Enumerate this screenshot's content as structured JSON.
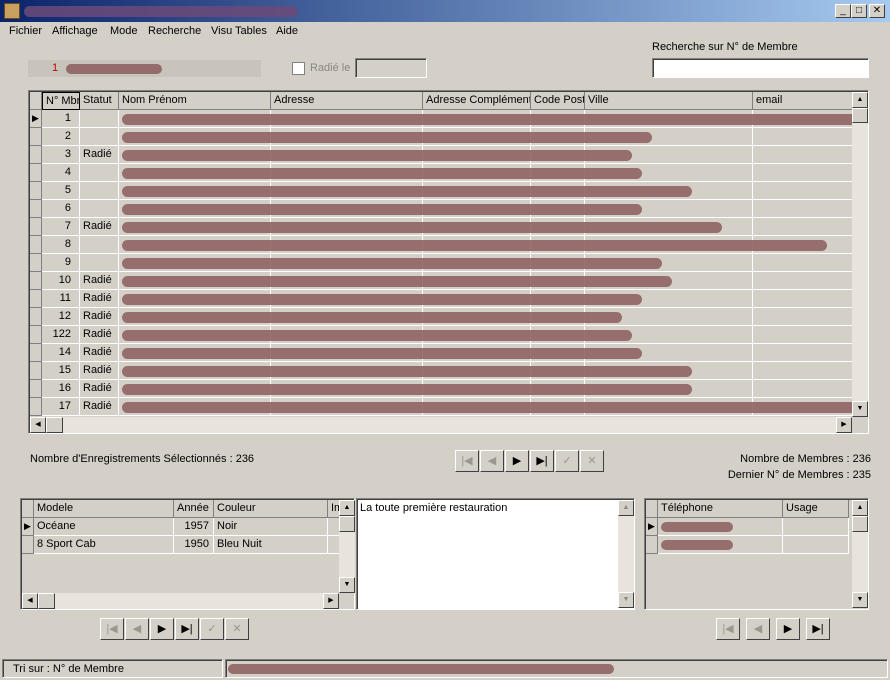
{
  "menu": [
    "Fichier",
    "Affichage",
    "Mode",
    "Recherche",
    "Visu Tables",
    "Aide"
  ],
  "header": {
    "current_id": "1",
    "radie_label": "Radié le",
    "search_label": "Recherche sur N° de Membre",
    "search_value": ""
  },
  "main_grid": {
    "columns": [
      "N° Mbr",
      "Statut",
      "Nom Prénom",
      "Adresse",
      "Adresse Complément",
      "Code Post",
      "Ville",
      "email"
    ],
    "rows": [
      {
        "id": "1",
        "statut": ""
      },
      {
        "id": "2",
        "statut": ""
      },
      {
        "id": "3",
        "statut": "Radié"
      },
      {
        "id": "4",
        "statut": ""
      },
      {
        "id": "5",
        "statut": ""
      },
      {
        "id": "6",
        "statut": ""
      },
      {
        "id": "7",
        "statut": "Radié"
      },
      {
        "id": "8",
        "statut": ""
      },
      {
        "id": "9",
        "statut": ""
      },
      {
        "id": "10",
        "statut": "Radié"
      },
      {
        "id": "11",
        "statut": "Radié"
      },
      {
        "id": "12",
        "statut": "Radié"
      },
      {
        "id": "122",
        "statut": "Radié"
      },
      {
        "id": "14",
        "statut": "Radié"
      },
      {
        "id": "15",
        "statut": "Radié"
      },
      {
        "id": "16",
        "statut": "Radié"
      },
      {
        "id": "17",
        "statut": "Radié"
      }
    ]
  },
  "info": {
    "selected": "Nombre d'Enregistrements Sélectionnés : 236",
    "members": "Nombre de Membres : 236",
    "last": "Dernier N° de Membres : 235"
  },
  "cars": {
    "columns": [
      "Modele",
      "Année",
      "Couleur",
      "Im"
    ],
    "rows": [
      {
        "modele": "Océane",
        "annee": "1957",
        "couleur": "Noir"
      },
      {
        "modele": "8 Sport Cab",
        "annee": "1950",
        "couleur": "Bleu Nuit"
      }
    ]
  },
  "memo": {
    "text": "La toute première restauration"
  },
  "phones": {
    "columns": [
      "Téléphone",
      "Usage"
    ]
  },
  "nav_glyphs": {
    "first": "|◀",
    "prev": "◀",
    "next": "▶",
    "last": "▶|",
    "post": "✓",
    "cancel": "✕"
  },
  "scroll_glyphs": {
    "up": "▲",
    "down": "▼",
    "left": "◀",
    "right": "▶"
  },
  "status": {
    "sort": "Tri sur : N° de Membre"
  },
  "colors": {
    "title_start": "#0a246a",
    "title_end": "#a6caf0",
    "face": "#d4d0c8",
    "id_text": "#c00000"
  }
}
